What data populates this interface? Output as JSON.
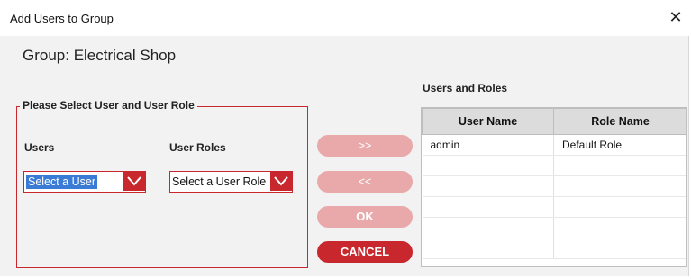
{
  "window": {
    "title": "Add Users to Group",
    "close_glyph": "✕"
  },
  "group": {
    "title": "Group: Electrical Shop"
  },
  "selection": {
    "legend": "Please Select User and User Role",
    "users_label": "Users",
    "roles_label": "User Roles",
    "user_select_value": "Select a User",
    "role_select_value": "Select a User Role"
  },
  "buttons": {
    "add": ">>",
    "remove": "<<",
    "ok": "OK",
    "cancel": "CANCEL"
  },
  "users_roles": {
    "title": "Users and Roles",
    "columns": [
      "User Name",
      "Role Name"
    ],
    "rows": [
      [
        "admin",
        "Default Role"
      ],
      [
        "",
        ""
      ],
      [
        "",
        ""
      ],
      [
        "",
        ""
      ],
      [
        "",
        ""
      ],
      [
        "",
        ""
      ]
    ]
  },
  "colors": {
    "accent": "#c9272e",
    "accent_faded": "#e9a9ab",
    "selection_highlight": "#3a7bd5",
    "dialog_background": "#f2f2f2"
  }
}
